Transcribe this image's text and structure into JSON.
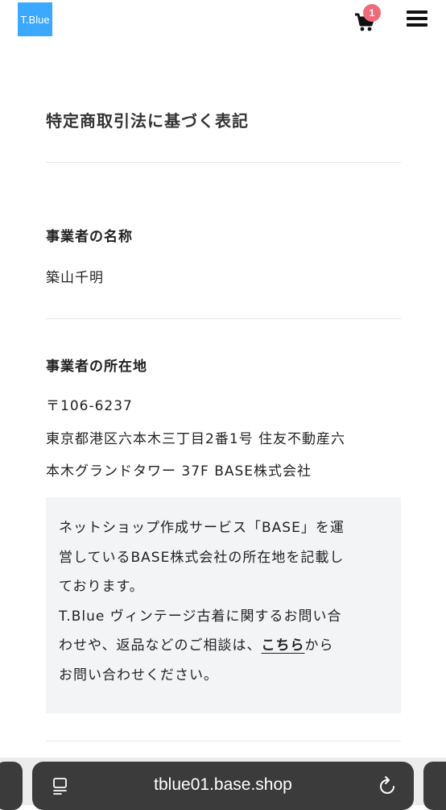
{
  "header": {
    "logo_text": "T.Blue",
    "cart_count": "1",
    "cart_icon": "cart-icon",
    "menu_icon": "hamburger-menu-icon",
    "logo_color": "#3aa9ff",
    "badge_color": "#f06b7a"
  },
  "page": {
    "title": "特定商取引法に基づく表記"
  },
  "sections": {
    "business_name": {
      "heading": "事業者の名称",
      "value": "築山千明"
    },
    "business_address": {
      "heading": "事業者の所在地",
      "postal": "〒106-6237",
      "address_line1": "東京都港区六本木三丁目2番1号 住友不動産六",
      "address_line2": "本木グランドタワー 37F BASE株式会社"
    }
  },
  "note": {
    "line1": "ネットショップ作成サービス「BASE」を運",
    "line2": "営しているBASE株式会社の所在地を記載し",
    "line3": "ております。",
    "line4": "T.Blue ヴィンテージ古着に関するお問い合",
    "line5_prefix": "わせや、返品などのご相談は、",
    "link_text": "こちら",
    "line5_suffix": "から",
    "line6": "お問い合わせください。"
  },
  "browser": {
    "url": "tblue01.base.shop",
    "tabs_icon": "tabs-icon",
    "reload_icon": "reload-icon"
  }
}
